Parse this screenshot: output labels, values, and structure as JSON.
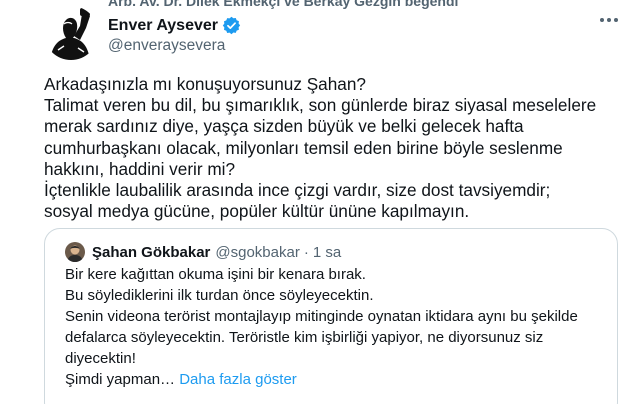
{
  "tweet": {
    "social_context": "Arb. Av. Dr. Dilek Ekmekçi ve Berkay Gezgin beğendi",
    "author": {
      "name": "Enver Aysever",
      "handle": "@enveraysevera",
      "verified": true
    },
    "more_icon": "more-horizontal-icon",
    "text_lines": [
      "Arkadaşınızla mı konuşuyorsunuz Şahan?",
      "Talimat veren bu dil, bu şımarıklık, son günlerde biraz siyasal meselelere",
      "merak sardınız diye, yaşça sizden büyük ve belki gelecek hafta",
      "cumhurbaşkanı olacak, milyonları temsil eden birine böyle seslenme",
      "hakkını, haddini verir mi?",
      "İçtenlikle laubalilik arasında ince çizgi vardır, size dost tavsiyemdir;",
      "sosyal medya gücüne, popüler kültür ününe kapılmayın."
    ]
  },
  "quote": {
    "author": {
      "name": "Şahan Gökbakar",
      "handle": "@sgokbakar",
      "separator": "·",
      "time": "1 sa"
    },
    "text_lines": [
      "Bir kere kağıttan okuma işini bir kenara bırak.",
      "Bu söylediklerini ilk turdan önce söyleyecektin.",
      "Senin videona terörist montajlayıp mitinginde oynatan iktidara aynı bu şekilde",
      "defalarca söyleyecektin. Teröristle kim işbirliği yapiyor, ne diyorsunuz siz",
      "diyecektin!"
    ],
    "last_line": "Şimdi yapman…",
    "show_more": "Daha fazla göster"
  },
  "colors": {
    "text": "#0f1419",
    "secondary": "#536471",
    "accent": "#1d9bf0",
    "border": "#cfd9de"
  }
}
